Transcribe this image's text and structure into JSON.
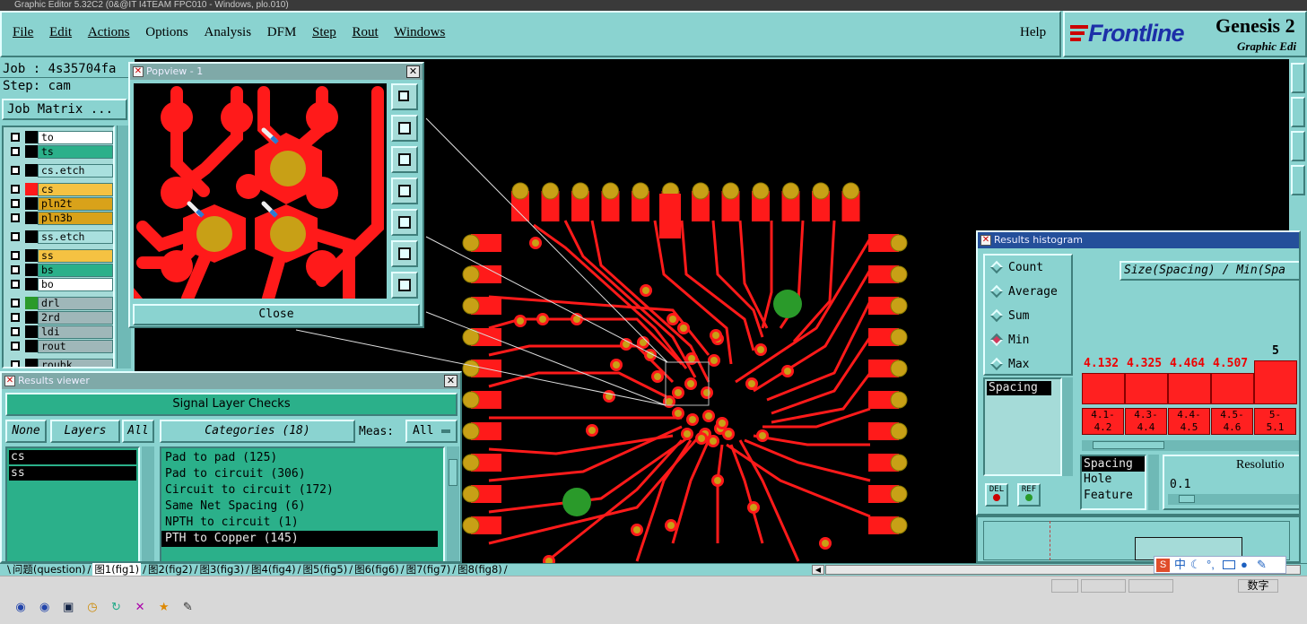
{
  "window_title": "Graphic Editor 5.32C2 (0&@IT I4TEAM FPC010 - Windows, plo.010)",
  "menu": {
    "file": "File",
    "edit": "Edit",
    "actions": "Actions",
    "options": "Options",
    "analysis": "Analysis",
    "dfm": "DFM",
    "step": "Step",
    "rout": "Rout",
    "windows": "Windows",
    "help": "Help"
  },
  "brand": {
    "logo": "Frontline",
    "product": "Genesis 2",
    "subtitle": "Graphic Edi"
  },
  "job": {
    "job_line": "Job : 4s35704fa",
    "step_line": "Step: cam",
    "matrix_button": "Job Matrix ..."
  },
  "layers": [
    {
      "name": "to",
      "color": "#ffffff",
      "swatch": "#000000"
    },
    {
      "name": "ts",
      "color": "#2bb08a",
      "swatch": "#000000"
    },
    {
      "name": "cs.etch",
      "color": "#a9e0de",
      "swatch": "#000000"
    },
    {
      "name": "cs",
      "color": "#f5c242",
      "swatch": "#ff1a1a"
    },
    {
      "name": "pln2t",
      "color": "#d9a21a",
      "swatch": "#000000"
    },
    {
      "name": "pln3b",
      "color": "#d9a21a",
      "swatch": "#000000"
    },
    {
      "name": "ss.etch",
      "color": "#a9e0de",
      "swatch": "#000000"
    },
    {
      "name": "ss",
      "color": "#f5c242",
      "swatch": "#000000"
    },
    {
      "name": "bs",
      "color": "#2bb08a",
      "swatch": "#000000"
    },
    {
      "name": "bo",
      "color": "#ffffff",
      "swatch": "#000000"
    },
    {
      "name": "drl",
      "color": "#9fb7b9",
      "swatch": "#2a9a2a"
    },
    {
      "name": "2rd",
      "color": "#9fb7b9",
      "swatch": "#000000"
    },
    {
      "name": "ldi",
      "color": "#9fb7b9",
      "swatch": "#000000"
    },
    {
      "name": "rout",
      "color": "#9fb7b9",
      "swatch": "#000000"
    },
    {
      "name": "roubk",
      "color": "#9fb7b9",
      "swatch": "#000000"
    }
  ],
  "popview": {
    "title": "Popview - 1",
    "close": "Close"
  },
  "results_viewer": {
    "title": "Results viewer",
    "heading": "Signal Layer Checks",
    "none_btn": "None",
    "layers_label": "Layers",
    "all_btn": "All",
    "layer_list": [
      "cs",
      "ss"
    ],
    "categories_label": "Categories (18)",
    "meas_label": "Meas:",
    "meas_value": "All",
    "categories": [
      "Pad to pad (125)",
      "Pad to circuit (306)",
      "Circuit to circuit (172)",
      "Same Net Spacing (6)",
      "NPTH to circuit (1)",
      "PTH to Copper (145)"
    ],
    "selected_category": 5
  },
  "histogram": {
    "title": "Results histogram",
    "options": [
      "Count",
      "Average",
      "Sum",
      "Min",
      "Max"
    ],
    "selected_option": "Min",
    "list_item": "Spacing",
    "del_btn": "DEL",
    "ref_btn": "REF",
    "axis_title": "Size(Spacing) / Min(Spa",
    "resolution_label": "Resolutio",
    "resolution_value": "0.1",
    "field_list": [
      "Spacing",
      "Hole",
      "Feature"
    ],
    "bars": [
      {
        "value": "4.132",
        "range": "4.1-\n4.2",
        "level": 0.77
      },
      {
        "value": "4.325",
        "range": "4.3-\n4.4",
        "level": 0.77
      },
      {
        "value": "4.464",
        "range": "4.4-\n4.5",
        "level": 0.77
      },
      {
        "value": "4.507",
        "range": "4.5-\n4.6",
        "level": 0.77
      },
      {
        "value": "5",
        "range": "5-\n5.1",
        "level": 0.95
      }
    ]
  },
  "tabs": [
    "问题(question)",
    "图1(fig1)",
    "图2(fig2)",
    "图3(fig3)",
    "图4(fig4)",
    "图5(fig5)",
    "图6(fig6)",
    "图7(fig7)",
    "图8(fig8)"
  ],
  "active_tab": 1,
  "status": {
    "ime_text": "中",
    "num_lock": "数字"
  },
  "colors": {
    "background": "#8ad3d0",
    "copper": "#ff1a1a",
    "pad": "#c8a016",
    "drill": "#2a9a2a",
    "canvas": "#000000"
  }
}
